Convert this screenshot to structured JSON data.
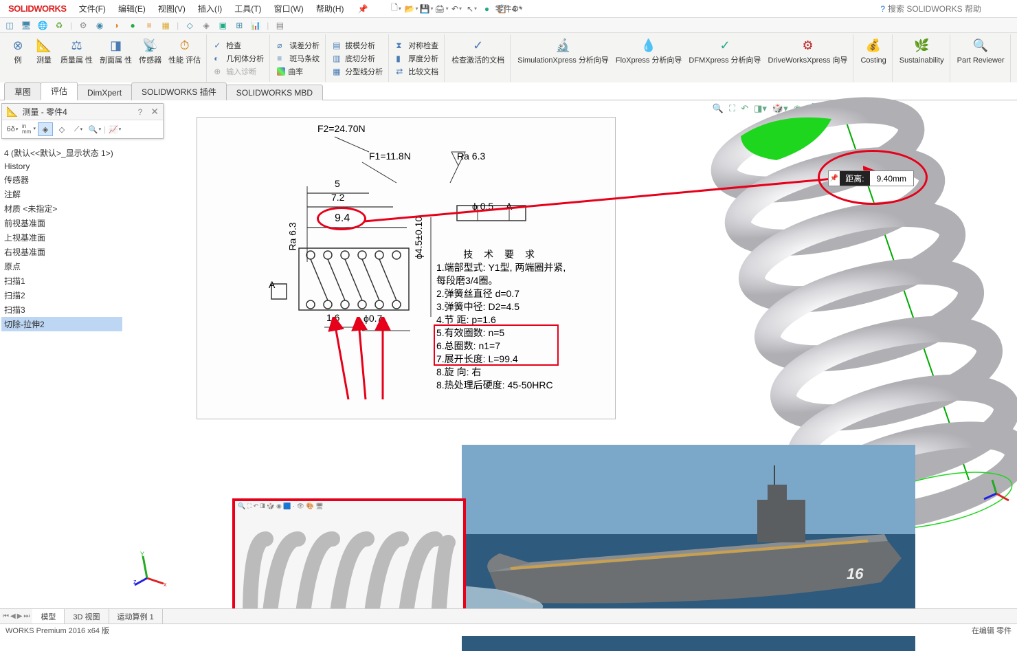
{
  "app": {
    "logo_solid": "SOLID",
    "logo_works": "WORKS"
  },
  "menu": {
    "file": "文件(F)",
    "edit": "编辑(E)",
    "view": "视图(V)",
    "insert": "插入(I)",
    "tools": "工具(T)",
    "window": "窗口(W)",
    "help": "帮助(H)"
  },
  "doc_title": "零件4 *",
  "search_placeholder": "搜索 SOLIDWORKS 帮助",
  "ribbon": {
    "r1": "例",
    "measure": "测量",
    "mass": "质量属\n性",
    "section": "剖面属\n性",
    "sensor": "传感器",
    "perf": "性能\n评估",
    "check": "检查",
    "geom": "几何体分析",
    "diag": "输入诊断",
    "err": "误差分析",
    "zebra": "斑马条纹",
    "curv": "曲率",
    "draft": "拔模分析",
    "undercut": "底切分析",
    "partline": "分型线分析",
    "sym": "对称检查",
    "thick": "厚度分析",
    "compare": "比较文档",
    "chkact": "检查激活的文档",
    "simx": "SimulationXpress\n分析向导",
    "flox": "FloXpress\n分析向导",
    "dfmx": "DFMXpress\n分析向导",
    "dwx": "DriveWorksXpress\n向导",
    "cost": "Costing",
    "sust": "Sustainability",
    "partrev": "Part\nReviewer"
  },
  "tabs": {
    "sketch": "草图",
    "eval": "评估",
    "dimx": "DimXpert",
    "swaddin": "SOLIDWORKS 插件",
    "swmbd": "SOLIDWORKS MBD"
  },
  "tree": {
    "root": "4 (默认<<默认>_显示状态 1>)",
    "history": "History",
    "sensors": "传感器",
    "annot": "注解",
    "mat": "材质 <未指定>",
    "front": "前视基准面",
    "top": "上视基准面",
    "right": "右视基准面",
    "origin": "原点",
    "sweep1": "扫描1",
    "sweep2": "扫描2",
    "sweep3": "扫描3",
    "cutext2": "切除-拉伸2"
  },
  "measure_panel": {
    "title": "测量 - 零件4",
    "b68": "6δ",
    "binmm": "in\nmm"
  },
  "callout": {
    "label": "距离:",
    "value": "9.40mm"
  },
  "drawing": {
    "f2": "F2=24.70N",
    "f1": "F1=11.8N",
    "ra": "Ra 6.3",
    "ra2": "Ra 6.3",
    "d5": "5",
    "d72": "7.2",
    "d94": "9.4",
    "d45": "ϕ4.5±0.10",
    "d16": "1.6",
    "d07": "ϕ0.7",
    "tol05": "ϕ 0.5",
    "datumA": "A",
    "datumA2": "A",
    "tech_req_title": "技 术 要 求",
    "r1": "1.端部型式: Y1型, 两端圈并紧,",
    "r1b": "   每段磨3/4圈。",
    "r2": "2.弹簧丝直径    d=0.7",
    "r3": "3.弹簧中径:    D2=4.5",
    "r4": "4.节 距:       p=1.6",
    "r5": "5.有效圈数:    n=5",
    "r6": "6.总圈数:      n1=7",
    "r7": "7.展开长度:    L=99.4",
    "r8": "8.旋 向:       右",
    "r9": "8.热处理后硬度: 45-50HRC"
  },
  "bottom_tabs": {
    "model": "模型",
    "v3d": "3D 视图",
    "motion": "运动算例 1"
  },
  "status": {
    "edition": "WORKS Premium 2016 x64 版",
    "edit_state": "在编辑 零件"
  }
}
